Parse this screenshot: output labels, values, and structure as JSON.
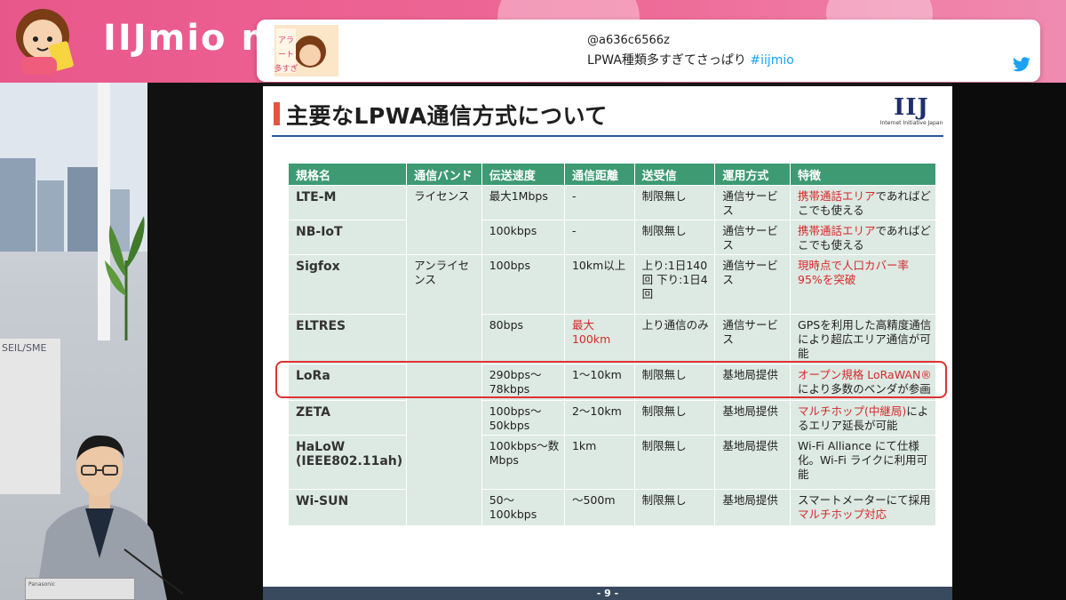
{
  "channel": {
    "title": "IIJmio m"
  },
  "tweet": {
    "handle": "@a636c6566z",
    "text": "LPWA種類多すぎてさっぱり",
    "hashtag": "#iijmio",
    "thumb_caption": "アラート多すぎ"
  },
  "studio": {
    "board_label": "SEIL/SME",
    "laptop_brand": "Panasonic"
  },
  "slide": {
    "title": "主要なLPWA通信方式について",
    "logo": {
      "mark": "IIJ",
      "sub": "Internet Initiative Japan"
    },
    "page": "- 9 -",
    "table": {
      "headers": [
        "規格名",
        "通信バンド",
        "伝送速度",
        "通信距離",
        "送受信",
        "運用方式",
        "特徴"
      ],
      "bands": {
        "licensed": "ライセンス",
        "unlicensed": "アンライセンス"
      },
      "rows": [
        {
          "name": "LTE-M",
          "speed": "最大1Mbps",
          "distance": "-",
          "txrx": "制限無し",
          "mode": "通信サービス",
          "feature_red": "携帯通話エリア",
          "feature": "であればどこでも使える"
        },
        {
          "name": "NB-IoT",
          "speed": "100kbps",
          "distance": "-",
          "txrx": "制限無し",
          "mode": "通信サービス",
          "feature_red": "携帯通話エリア",
          "feature": "であればどこでも使える"
        },
        {
          "name": "Sigfox",
          "speed": "100bps",
          "distance": "10km以上",
          "txrx": "上り:1日140回 下り:1日4回",
          "mode": "通信サービス",
          "feature_red": "現時点で人口カバー率95%を突破",
          "feature": ""
        },
        {
          "name": "ELTRES",
          "speed": "80bps",
          "distance": "最大100km",
          "txrx": "上り通信のみ",
          "mode": "通信サービス",
          "feature_red": "",
          "feature": "GPSを利用した高精度通信により超広エリア通信が可能"
        },
        {
          "name": "LoRa",
          "speed": "290bps〜78kbps",
          "distance": "1〜10km",
          "txrx": "制限無し",
          "mode": "基地局提供",
          "feature_red": "オープン規格 LoRaWAN®",
          "feature": "により多数のベンダが参画"
        },
        {
          "name": "ZETA",
          "speed": "100bps〜50kbps",
          "distance": "2〜10km",
          "txrx": "制限無し",
          "mode": "基地局提供",
          "feature_red": "マルチホップ(中継局)",
          "feature": "によるエリア延長が可能"
        },
        {
          "name": "HaLoW (IEEE802.11ah)",
          "speed": "100kbps〜数Mbps",
          "distance": "1km",
          "txrx": "制限無し",
          "mode": "基地局提供",
          "feature_red": "",
          "feature": "Wi-Fi Alliance にて仕様化。Wi-Fi ライクに利用可能"
        },
        {
          "name": "Wi-SUN",
          "speed": "50〜100kbps",
          "distance": "〜500m",
          "txrx": "制限無し",
          "mode": "基地局提供",
          "feature_red": "マルチホップ対応",
          "feature": "スマートメーターにて採用"
        }
      ]
    }
  },
  "colors": {
    "banner": "#e9578a",
    "header_green": "#3d9a72",
    "cell_green": "#dde9e3",
    "accent_red": "#d42a2a",
    "title_rule": "#2b5597"
  }
}
